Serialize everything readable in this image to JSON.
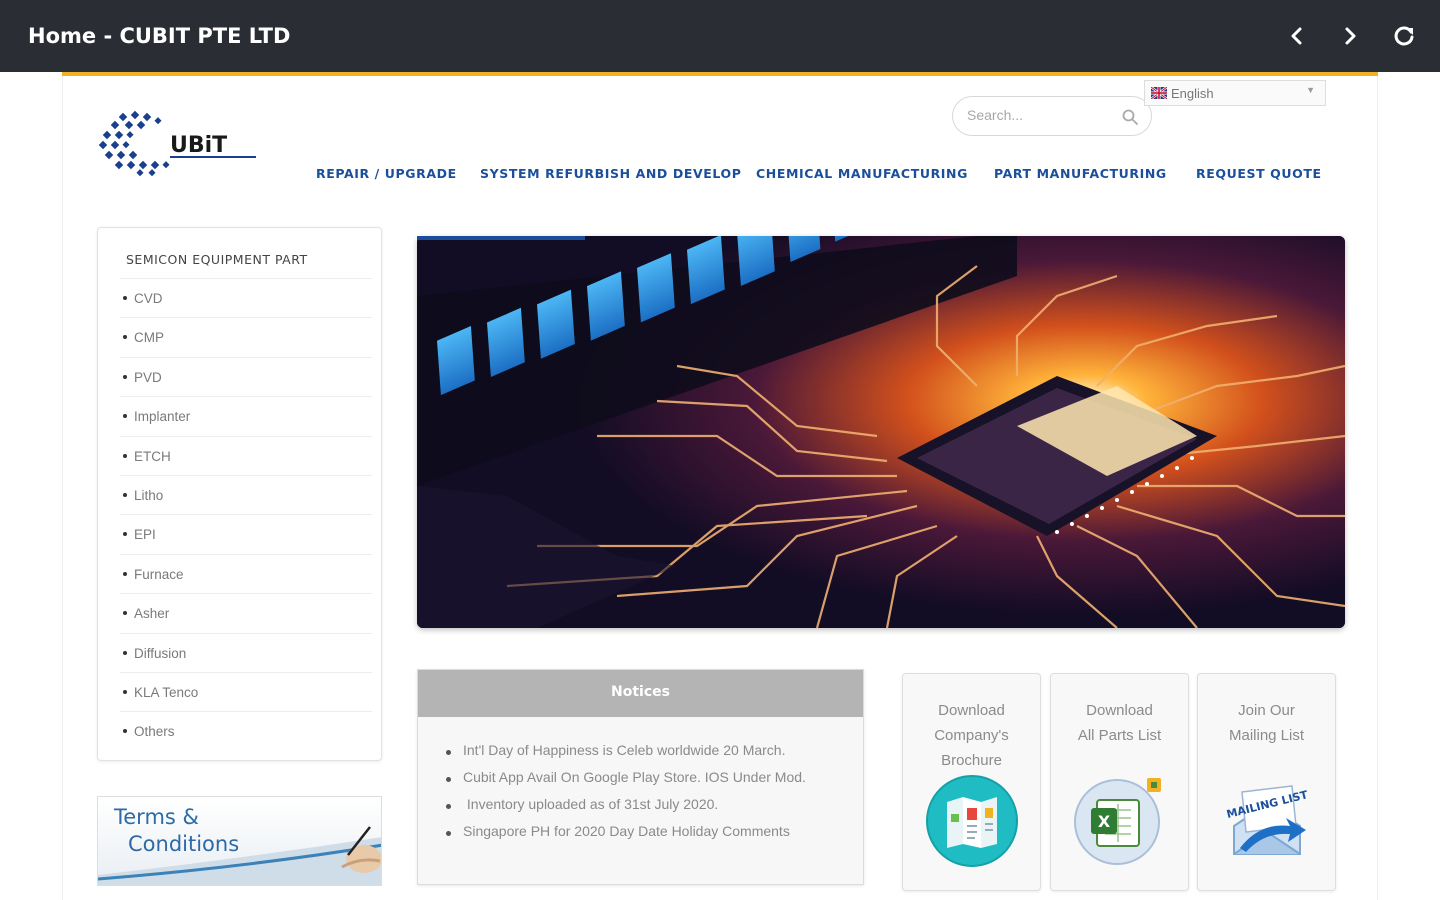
{
  "appbar": {
    "title": "Home - CUBIT PTE LTD",
    "back_icon": "chevron-left-icon",
    "forward_icon": "chevron-right-icon",
    "reload_icon": "reload-icon"
  },
  "brand": {
    "logo_text": "UBiT",
    "colors": {
      "primary": "#1b4f9c",
      "accent": "#f2b120",
      "appbar": "#2a2d33"
    }
  },
  "search": {
    "placeholder": "Search..."
  },
  "language": {
    "selected": "English"
  },
  "nav": {
    "items": [
      "REPAIR / UPGRADE",
      "SYSTEM REFURBISH AND DEVELOP",
      "CHEMICAL MANUFACTURING",
      "PART MANUFACTURING",
      "REQUEST QUOTE"
    ]
  },
  "sidebar": {
    "title": "SEMICON EQUIPMENT PART",
    "items": [
      "CVD",
      "CMP",
      "PVD",
      "Implanter",
      "ETCH",
      "Litho",
      "EPI",
      "Furnace",
      "Asher",
      "Diffusion",
      "KLA Tenco",
      "Others"
    ]
  },
  "terms": {
    "line1": "Terms &",
    "line2": "Conditions"
  },
  "notices": {
    "title": "Notices",
    "items": [
      "Int'l Day of Happiness is Celeb worldwide 20 March.",
      "Cubit App Avail On Google Play Store. IOS Under Mod.",
      " Inventory uploaded as of 31st July 2020.",
      "Singapore PH for 2020 Day Date Holiday Comments"
    ]
  },
  "cards": [
    {
      "label": "Download\nCompany's\nBrochure",
      "icon": "brochure-icon"
    },
    {
      "label": "Download\nAll Parts List",
      "icon": "excel-icon"
    },
    {
      "label": "Join Our\nMailing List",
      "icon": "mailing-list-icon",
      "icon_text": "MAILING LIST"
    }
  ]
}
